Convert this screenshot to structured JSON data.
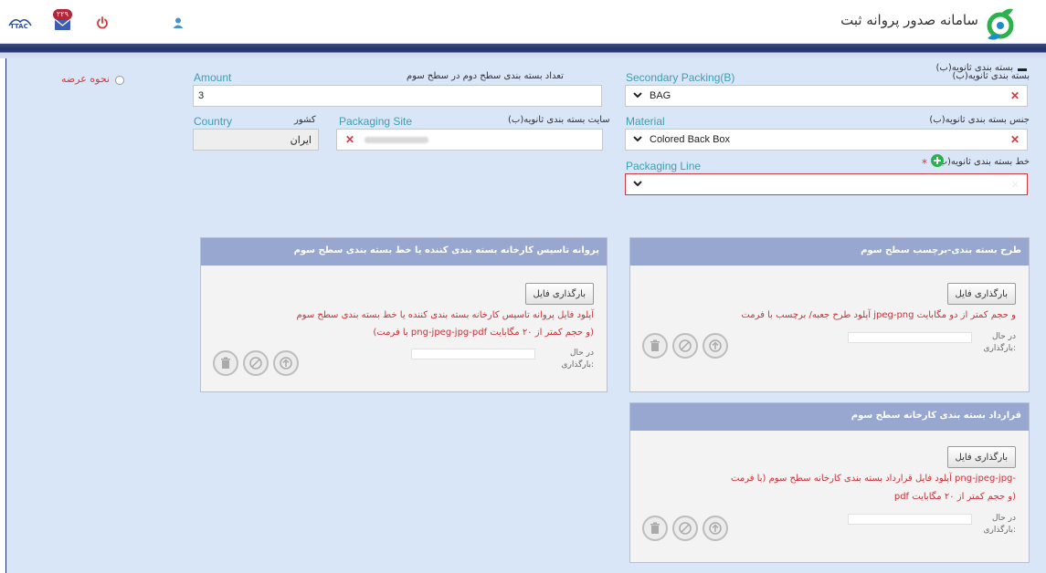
{
  "app": {
    "title": "سامانه صدور پروانه ثبت"
  },
  "topbar": {
    "notification_count": "۲۲۹"
  },
  "section": {
    "title": "بسته بندی ثانویه(ب)"
  },
  "form": {
    "secondary_packing": {
      "fa_label": "بسته بندی ثانویه(ب)",
      "en_label": "Secondary Packing(B)",
      "value": "BAG"
    },
    "amount": {
      "fa_label": "تعداد بسته بندی سطح دوم در سطح سوم",
      "en_label": "Amount",
      "value": "3"
    },
    "presentation": {
      "label": "نحوه عرضه"
    },
    "material": {
      "fa_label": "جنس بسته بندی ثانویه(ب)",
      "en_label": "Material",
      "value": "Colored Back Box"
    },
    "packaging_site": {
      "fa_label": "سایت بسته بندی ثانویه(ب)",
      "en_label": "Packaging Site"
    },
    "country": {
      "fa_label": "کشور",
      "en_label": "Country",
      "value": "ایران"
    },
    "packaging_line": {
      "fa_label": "خط بسته بندی ثانویه(ب)",
      "en_label": "Packaging Line",
      "required_mark": "*"
    }
  },
  "panels": {
    "license": {
      "title": "پروانه تاسیس کارخانه بسته بندی کننده یا خط بسته بندی سطح سوم",
      "button": "بارگذاری فایل",
      "desc_line1": "آپلود فایل پروانه تاسیس کارخانه بسته بندی کننده یا خط بسته بندی سطح سوم",
      "desc_line2": "(با فرمت png-jpeg-jpg-pdf و حجم کمتر از ۲۰ مگابایت)",
      "status_label": "در حال بارگذاری:"
    },
    "label_design": {
      "title": "طرح بسته بندی-برچسب سطح سوم",
      "button": "بارگذاری فایل",
      "desc_line1": "آپلود طرح جعبه/ برچسب با فرمت jpeg-png و حجم کمتر از دو مگابایت",
      "status_label": "در حال بارگذاری:"
    },
    "contract": {
      "title": "قرارداد بسته بندی کارخانه سطح سوم",
      "button": "بارگذاری فایل",
      "desc_line1": "آپلود فایل قرارداد بسته بندی کارخانه سطح سوم (با فرمت png-jpeg-jpg-",
      "desc_line2": "pdf و حجم کمتر از ۲۰ مگابایت)",
      "status_label": "در حال بارگذاری:"
    }
  },
  "colors": {
    "accent_teal": "#3a9fb0",
    "error_red": "#d0393e",
    "panel_header": "#97a7cf",
    "page_bg": "#d9e6f8",
    "brand_green": "#2bb24c"
  }
}
